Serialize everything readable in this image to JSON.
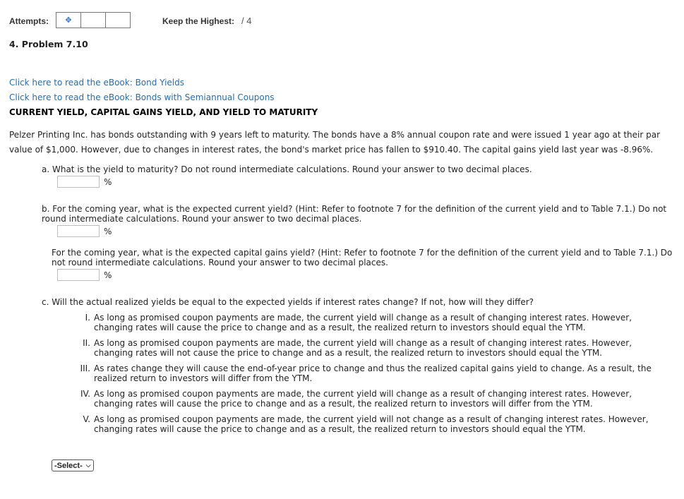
{
  "header": {
    "attempts_label": "Attempts:",
    "attempt_icon": "✥",
    "keep_label": "Keep the Highest:",
    "keep_value": "/ 4"
  },
  "problem": {
    "title": "4.  Problem 7.10",
    "links": [
      "Click here to read the eBook: Bond Yields",
      "Click here to read the eBook: Bonds with Semiannual Coupons"
    ],
    "heading": "CURRENT YIELD, CAPITAL GAINS YIELD, AND YIELD TO MATURITY",
    "intro": "Pelzer Printing Inc. has bonds outstanding with 9 years left to maturity. The bonds have a 8% annual coupon rate and were issued 1 year ago at their par value of $1,000. However, due to changes in interest rates, the bond's market price has fallen to $910.40. The capital gains yield last year was -8.96%."
  },
  "questions": {
    "a": {
      "text": "a. What is the yield to maturity? Do not round intermediate calculations. Round your answer to two decimal places.",
      "value": "",
      "unit": "%"
    },
    "b1": {
      "text": "b. For the coming year, what is the expected current yield? (Hint: Refer to footnote 7 for the definition of the current yield and to Table 7.1.) Do not round intermediate calculations. Round your answer to two decimal places.",
      "value": "",
      "unit": "%"
    },
    "b2": {
      "text": "For the coming year, what is the expected capital gains yield? (Hint: Refer to footnote 7 for the definition of the current yield and to Table 7.1.) Do not round intermediate calculations. Round your answer to two decimal places.",
      "value": "",
      "unit": "%"
    },
    "c": {
      "text": "c. Will the actual realized yields be equal to the expected yields if interest rates change? If not, how will they differ?",
      "options": [
        {
          "num": "I.",
          "text": "As long as promised coupon payments are made, the current yield will change as a result of changing interest rates. However, changing rates will cause the price to change and as a result, the realized return to investors should equal the YTM."
        },
        {
          "num": "II.",
          "text": "As long as promised coupon payments are made, the current yield will change as a result of changing interest rates. However, changing rates will not cause the price to change and as a result, the realized return to investors should equal the YTM."
        },
        {
          "num": "III.",
          "text": "As rates change they will cause the end-of-year price to change and thus the realized capital gains yield to change. As a result, the realized return to investors will differ from the YTM."
        },
        {
          "num": "IV.",
          "text": "As long as promised coupon payments are made, the current yield will change as a result of changing interest rates. However, changing rates will cause the price to change and as a result, the realized return to investors will differ from the YTM."
        },
        {
          "num": "V.",
          "text": "As long as promised coupon payments are made, the current yield will not change as a result of changing interest rates. However, changing rates will cause the price to change and as a result, the realized return to investors should equal the YTM."
        }
      ],
      "select_label": "-Select-"
    }
  }
}
